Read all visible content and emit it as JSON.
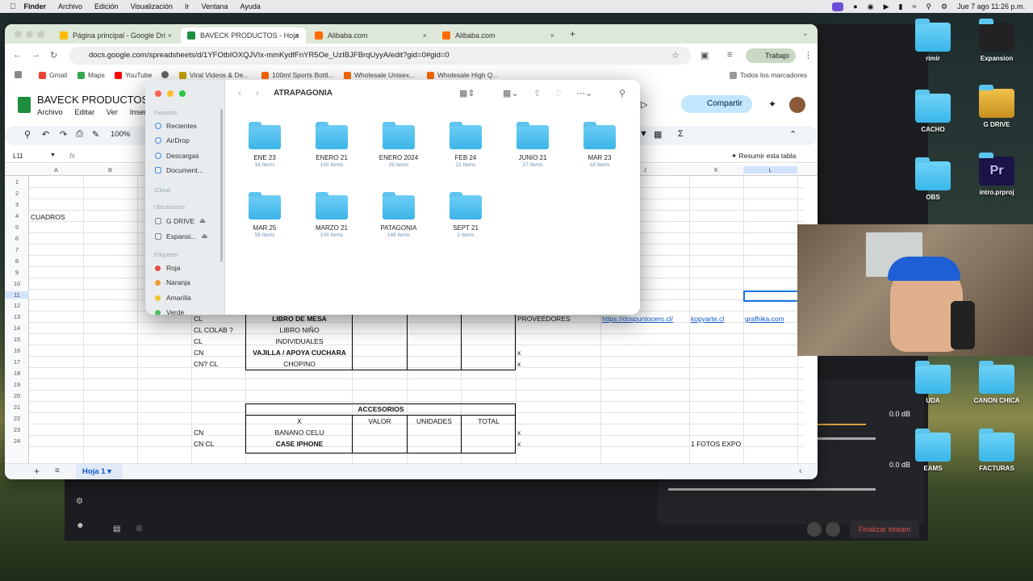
{
  "menubar": {
    "app": "Finder",
    "items": [
      "Archivo",
      "Edición",
      "Visualización",
      "Ir",
      "Ventana",
      "Ayuda"
    ],
    "clock": "Jue 7 ago 11:26 p.m."
  },
  "desktop": {
    "icons": [
      "Expansion",
      "G DRIVE",
      "intro.prproj",
      "CANON CHICA",
      "FACTURAS"
    ],
    "partial": [
      "rimir",
      "CACHO",
      "OBS",
      "UDA",
      "EAMS"
    ]
  },
  "obs": {
    "db1": "0.0 dB",
    "db2": "0.0 dB",
    "end_stream": "Finalizar stream"
  },
  "chrome": {
    "tabs": [
      "Página principal - Google Dri",
      "BAVECK PRODUCTOS - Hoja",
      "Alibaba.com",
      "Alibaba.com"
    ],
    "url": "docs.google.com/spreadsheets/d/1YFOtbIOXQJVIx-mmKydfFnYR5Oe_UzIBJFBrqUyyA/edit?gid=0#gid=0",
    "profile": "Trabajo",
    "bookmarks": [
      "Gmail",
      "Maps",
      "YouTube",
      "Viral Videos & De...",
      "100ml Sports Bottl...",
      "Wholesale Unisex...",
      "Wholesale High Q...",
      "Todos los marcadores"
    ]
  },
  "sheets": {
    "title": "BAVECK PRODUCTOS",
    "menu": [
      "Archivo",
      "Editar",
      "Ver",
      "Insertar"
    ],
    "share": "Compartir",
    "zoom": "100%",
    "cell_ref": "L11",
    "summarize": "Resumir esta tabla",
    "columns": [
      "A",
      "B",
      "J",
      "K",
      "L"
    ],
    "rows": [
      "1",
      "2",
      "3",
      "4",
      "5",
      "6",
      "7",
      "8",
      "9",
      "10",
      "11",
      "12",
      "13",
      "14",
      "15",
      "16",
      "17",
      "18",
      "19",
      "20",
      "21",
      "22",
      "23",
      "24"
    ],
    "a4": "CUADROS",
    "r13": {
      "c": "CL",
      "name": "LIBRO DE MESA",
      "i": "PROVEEDORES",
      "j": "https://dospuntocero.cl/",
      "k": "kopyarte.cl",
      "l": "grafhika.com"
    },
    "r14": {
      "c": "CL COLAB ?",
      "name": "LIBRO NIÑO"
    },
    "r15": {
      "c": "CL",
      "name": "INDIVIDUALES"
    },
    "r16": {
      "c": "CN",
      "name": "VAJILLA / APOYA CUCHARA",
      "i": "x"
    },
    "r17": {
      "c": "CN? CL",
      "name": "CHOPINO",
      "i": "x"
    },
    "acc_title": "ACCESORIOS",
    "acc_headers": [
      "X",
      "VALOR",
      "UNIDADES",
      "TOTAL"
    ],
    "r23": {
      "c": "CN",
      "name": "BANANO CELU",
      "i": "x"
    },
    "r24": {
      "c": "CN CL",
      "name": "CASE IPHONE",
      "i": "x",
      "k": "1 FOTOS EXPO"
    },
    "sheet_tab": "Hoja 1"
  },
  "finder": {
    "title": "ATRAPAGONIA",
    "sidebar": {
      "favoritos": "Favoritos",
      "fav": [
        "Recientes",
        "AirDrop",
        "Descargas",
        "Document..."
      ],
      "icloud": "iCloud",
      "ubicaciones": "Ubicaciones",
      "loc": [
        "G DRIVE",
        "Expansi..."
      ],
      "etiquetas": "Etiquetas",
      "tags": [
        "Roja",
        "Naranja",
        "Amarilla",
        "Verde"
      ]
    },
    "folders": [
      {
        "name": "ENE 23",
        "count": "18 ítems"
      },
      {
        "name": "ENERO 21",
        "count": "105 ítems"
      },
      {
        "name": "ENERO 2024",
        "count": "29 ítems"
      },
      {
        "name": "FEB 24",
        "count": "21 ítems"
      },
      {
        "name": "JUNIO 21",
        "count": "27 ítems"
      },
      {
        "name": "MAR 23",
        "count": "18 ítems"
      },
      {
        "name": "MAR 25",
        "count": "58 ítems"
      },
      {
        "name": "MARZO 21",
        "count": "109 ítems"
      },
      {
        "name": "PATAGONIA",
        "count": "148 ítems"
      },
      {
        "name": "SEPT 21",
        "count": "2 ítems"
      }
    ]
  }
}
